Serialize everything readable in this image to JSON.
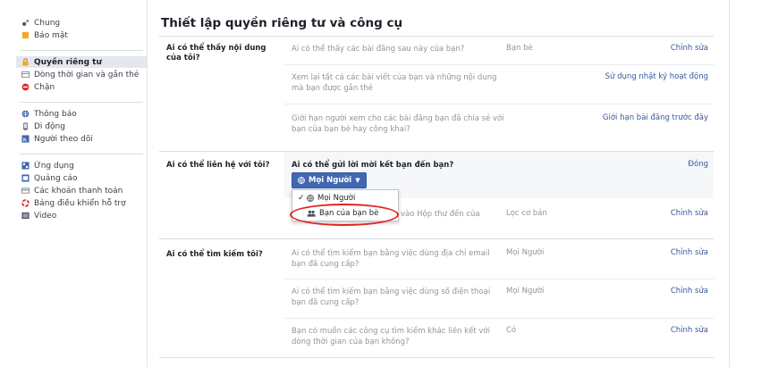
{
  "sidebar": {
    "groups": [
      [
        {
          "label": "Chung",
          "icon": "gear-icon",
          "color": "#4d5562"
        },
        {
          "label": "Bảo mật",
          "icon": "shield-icon",
          "color": "#f5a623"
        }
      ],
      [
        {
          "label": "Quyền riêng tư",
          "icon": "lock-icon",
          "color": "#f5a623",
          "active": true
        },
        {
          "label": "Dòng thời gian và gắn thẻ",
          "icon": "timeline-icon",
          "color": "#7f8791"
        },
        {
          "label": "Chặn",
          "icon": "block-icon",
          "color": "#e02424"
        }
      ],
      [
        {
          "label": "Thông báo",
          "icon": "globe-icon",
          "color": "#4267b2"
        },
        {
          "label": "Di động",
          "icon": "mobile-icon",
          "color": "#4d5562"
        },
        {
          "label": "Người theo dõi",
          "icon": "rss-icon",
          "color": "#4267b2"
        }
      ],
      [
        {
          "label": "Ứng dụng",
          "icon": "apps-icon",
          "color": "#4267b2"
        },
        {
          "label": "Quảng cáo",
          "icon": "ads-icon",
          "color": "#4267b2"
        },
        {
          "label": "Các khoản thanh toán",
          "icon": "card-icon",
          "color": "#7f8791"
        },
        {
          "label": "Bảng điều khiển hỗ trợ",
          "icon": "lifebuoy-icon",
          "color": "#e02424"
        },
        {
          "label": "Video",
          "icon": "video-icon",
          "color": "#4d5562"
        }
      ]
    ]
  },
  "main": {
    "title": "Thiết lập quyền riêng tư và công cụ",
    "sections": {
      "s1": {
        "label": "Ai có thể thấy nội dung của tôi?",
        "rows": [
          {
            "q": "Ai có thể thấy các bài đăng sau này của bạn?",
            "v": "Bạn bè",
            "a": "Chỉnh sửa"
          },
          {
            "q": "Xem lại tất cả các bài viết của bạn và những nội dung mà bạn được gắn thẻ",
            "v": "",
            "a": "Sử dụng nhật ký hoạt động"
          },
          {
            "q": "Giới hạn người xem cho các bài đăng bạn đã chia sẻ với bạn của bạn bè hay công khai?",
            "v": "",
            "a": "Giới hạn bài đăng trước đây"
          }
        ]
      },
      "s2": {
        "label": "Ai có thể liên hệ với tôi?",
        "expanded_q": "Ai có thể gửi lời mời kết bạn đến bạn?",
        "close": "Đóng",
        "button": "Mọi Người",
        "dropdown": [
          {
            "label": "Mọi Người",
            "checked": true
          },
          {
            "label": "Bạn của bạn bè",
            "checked": false
          }
        ],
        "row2": {
          "q": "vào Hộp thư đến của",
          "v": "Lọc cơ bản",
          "a": "Chỉnh sửa"
        }
      },
      "s3": {
        "label": "Ai có thể tìm kiếm tôi?",
        "rows": [
          {
            "q": "Ai có thể tìm kiếm bạn bằng việc dùng địa chỉ email bạn đã cung cấp?",
            "v": "Mọi Người",
            "a": "Chỉnh sửa"
          },
          {
            "q": "Ai có thể tìm kiếm bạn bằng việc dùng số điện thoại bạn đã cung cấp?",
            "v": "Mọi Người",
            "a": "Chỉnh sửa"
          },
          {
            "q": "Bạn có muốn các công cụ tìm kiếm khác liên kết với dòng thời gian của bạn không?",
            "v": "Có",
            "a": "Chỉnh sửa"
          }
        ]
      }
    }
  }
}
